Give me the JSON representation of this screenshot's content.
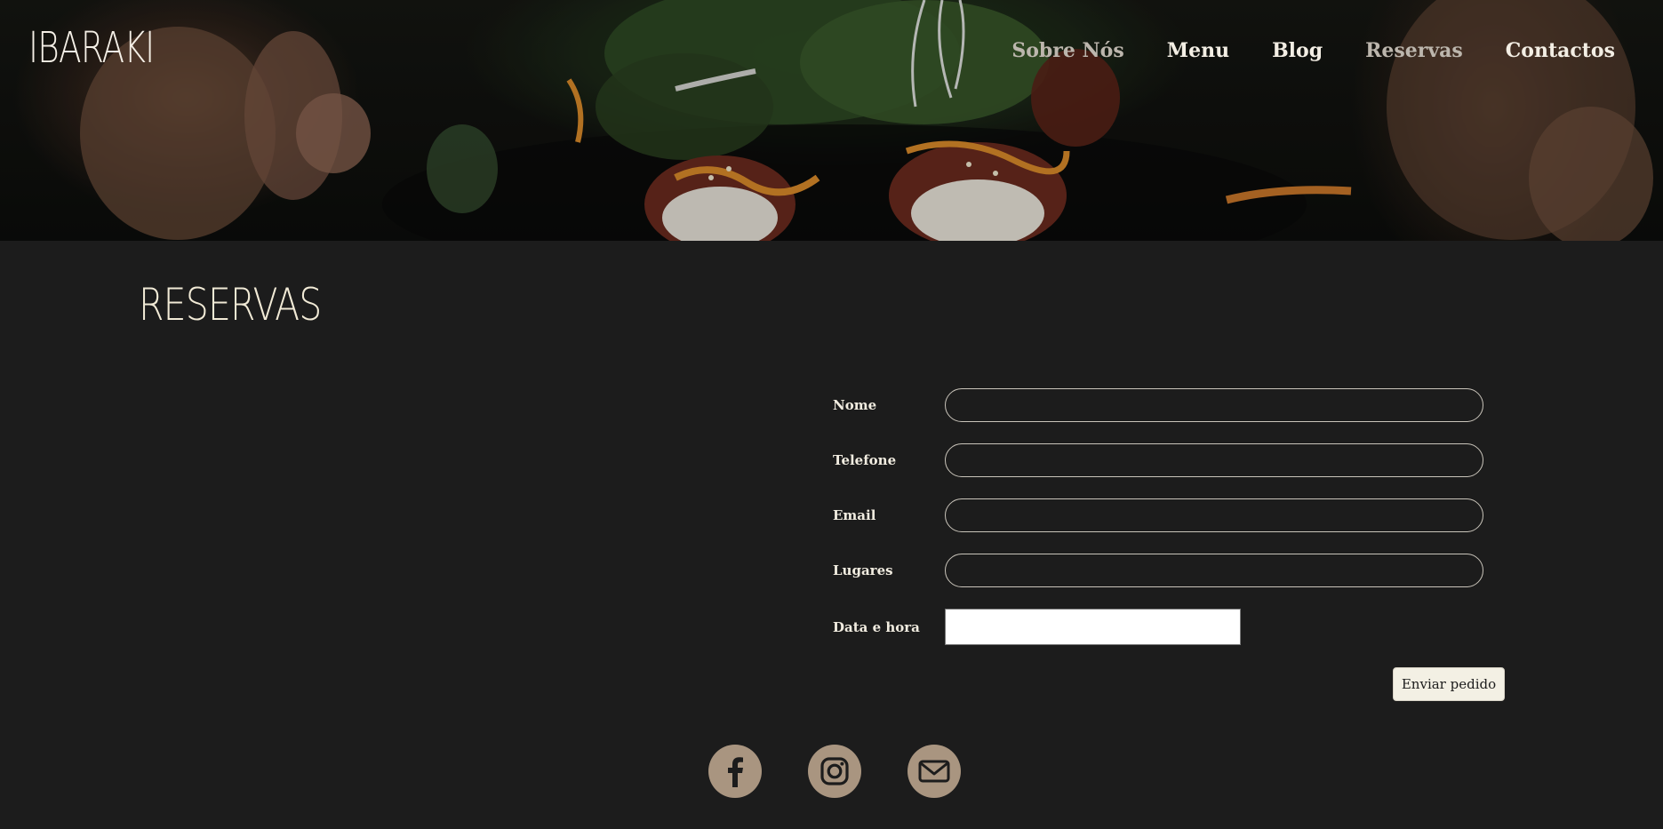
{
  "brand": {
    "logo_text": "IBARAKI"
  },
  "nav": {
    "items": [
      {
        "label": "Sobre Nós",
        "active": false
      },
      {
        "label": "Menu",
        "active": false
      },
      {
        "label": "Blog",
        "active": false
      },
      {
        "label": "Reservas",
        "active": true
      },
      {
        "label": "Contactos",
        "active": false
      }
    ]
  },
  "page": {
    "title": "RESERVAS"
  },
  "form": {
    "fields": [
      {
        "label": "Nome",
        "value": ""
      },
      {
        "label": "Telefone",
        "value": ""
      },
      {
        "label": "Email",
        "value": ""
      },
      {
        "label": "Lugares",
        "value": ""
      },
      {
        "label": "Data e hora",
        "value": ""
      }
    ],
    "submit_label": "Enviar pedido"
  },
  "social": {
    "icons": [
      "facebook-icon",
      "instagram-icon",
      "email-icon"
    ]
  },
  "colors": {
    "background": "#1c1c1c",
    "text_light": "#f1ece0",
    "social_circle": "#a99580",
    "button_bg": "#f3f0e4"
  }
}
